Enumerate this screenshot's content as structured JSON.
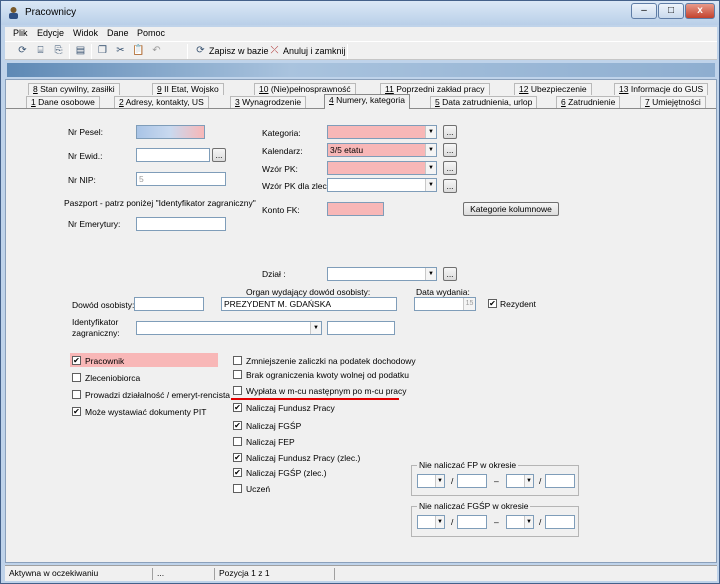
{
  "window": {
    "title": "Pracownicy",
    "buttons": {
      "minimize": "–",
      "maximize": "□",
      "close": "x"
    }
  },
  "menu": [
    "Plik",
    "Edycje",
    "Widok",
    "Dane",
    "Pomoc"
  ],
  "toolbar": {
    "icons": [
      "refresh-icon",
      "tree-icon",
      "save-copy-icon",
      "print-icon",
      "copy-icon",
      "cut-icon",
      "paste-icon",
      "undo-icon"
    ],
    "save_label": "Zapisz w bazie",
    "cancel_label": "Anuluj i zamknij"
  },
  "tabs_row1": [
    {
      "num": "8",
      "label": "Stan cywilny, zasiłki"
    },
    {
      "num": "9",
      "label": "II Etat, Wojsko"
    },
    {
      "num": "10",
      "label": "(Nie)pełnosprawność"
    },
    {
      "num": "11",
      "label": "Poprzedni zakład pracy"
    },
    {
      "num": "12",
      "label": "Ubezpieczenie"
    },
    {
      "num": "13",
      "label": "Informacje do GUS"
    }
  ],
  "tabs_row2": [
    {
      "num": "1",
      "label": "Dane osobowe"
    },
    {
      "num": "2",
      "label": "Adresy, kontakty, US"
    },
    {
      "num": "3",
      "label": "Wynagrodzenie"
    },
    {
      "num": "4",
      "label": "Numery, kategoria"
    },
    {
      "num": "5",
      "label": "Data zatrudnienia, urlop"
    },
    {
      "num": "6",
      "label": "Zatrudnienie"
    },
    {
      "num": "7",
      "label": "Umiejętności"
    }
  ],
  "form": {
    "pesel_label": "Nr Pesel:",
    "pesel_value": "",
    "ewid_label": "Nr Ewid.:",
    "ewid_value": "",
    "nip_label": "Nr NIP:",
    "nip_value": "5",
    "paszport_note": "Paszport - patrz poniżej \"Identyfikator zagraniczny\"",
    "emerytury_label": "Nr Emerytury:",
    "emerytury_value": "",
    "kategoria_label": "Kategoria:",
    "kategoria_value": "",
    "kalendarz_label": "Kalendarz:",
    "kalendarz_value": "3/5 etatu",
    "wzor_pk_label": "Wzór PK:",
    "wzor_pk_value": "",
    "wzor_pk_zlec_label": "Wzór PK dla zlec.:",
    "wzor_pk_zlec_value": "",
    "konto_fk_label": "Konto FK:",
    "konto_fk_value": "",
    "kategorie_btn": "Kategorie kolumnowe",
    "dzial_label": "Dział :",
    "dzial_value": "",
    "organ_label": "Organ wydający dowód osobisty:",
    "organ_value": "PREZYDENT M. GDAŃSKA",
    "data_wydania_label": "Data wydania:",
    "data_wydania_value": "",
    "calendar_btn": "15",
    "dowod_label": "Dowód osobisty:",
    "dowod_value": "",
    "rezydent_label": "Rezydent",
    "ident_label_1": "Identyfikator",
    "ident_label_2": "zagraniczny:",
    "ident_value": "",
    "ident_extra_value": "",
    "ellipsis": "..."
  },
  "left_checks": [
    {
      "label": "Pracownik",
      "checked": "✔"
    },
    {
      "label": "Zleceniobiorca",
      "checked": ""
    },
    {
      "label": "Prowadzi działalność / emeryt-rencista",
      "checked": ""
    },
    {
      "label": "Może wystawiać dokumenty PIT",
      "checked": "✔"
    }
  ],
  "right_checks": [
    {
      "label": "Zmniejszenie zaliczki na podatek dochodowy",
      "checked": ""
    },
    {
      "label": "Brak ograniczenia kwoty wolnej od podatku",
      "checked": ""
    },
    {
      "label": "Wypłata w m-cu następnym po m-cu pracy",
      "checked": ""
    },
    {
      "label": "Naliczaj Fundusz Pracy",
      "checked": "✔"
    },
    {
      "label": "Naliczaj FGŚP",
      "checked": "✔"
    },
    {
      "label": "Naliczaj FEP",
      "checked": ""
    },
    {
      "label": "Naliczaj Fundusz Pracy (zlec.)",
      "checked": "✔"
    },
    {
      "label": "Naliczaj FGŚP (zlec.)",
      "checked": "✔"
    },
    {
      "label": "Uczeń",
      "checked": ""
    }
  ],
  "group_fp": {
    "title": "Nie naliczać FP w okresie",
    "slash": "/",
    "dash": "–"
  },
  "group_fgsp": {
    "title": "Nie naliczać FGŚP w okresie",
    "slash": "/",
    "dash": "–"
  },
  "status": {
    "state": "Aktywna w oczekiwaniu",
    "middle": "...",
    "position": "Pozycja 1 z 1"
  },
  "colors": {
    "required_field": "#f8b7b7",
    "highlight_underline": "#e00000"
  }
}
